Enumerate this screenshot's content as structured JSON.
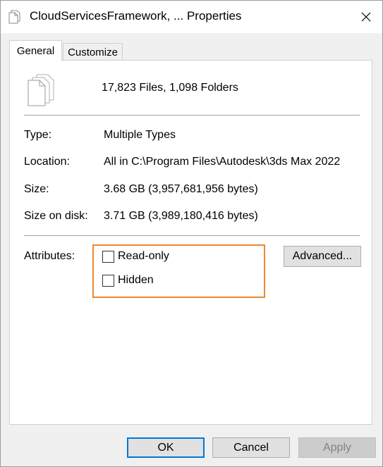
{
  "window": {
    "title": "CloudServicesFramework, ... Properties",
    "close_label": "✕"
  },
  "tabs": [
    {
      "label": "General",
      "active": true
    },
    {
      "label": "Customize",
      "active": false
    }
  ],
  "summary": "17,823 Files, 1,098 Folders",
  "details": [
    {
      "label": "Type:",
      "value": "Multiple Types"
    },
    {
      "label": "Location:",
      "value": "All in C:\\Program Files\\Autodesk\\3ds Max 2022"
    },
    {
      "label": "Size:",
      "value": "3.68 GB (3,957,681,956 bytes)"
    },
    {
      "label": "Size on disk:",
      "value": "3.71 GB (3,989,180,416 bytes)"
    }
  ],
  "attributes": {
    "label": "Attributes:",
    "read_only": {
      "label": "Read-only",
      "checked": false
    },
    "hidden": {
      "label": "Hidden",
      "checked": false
    },
    "advanced_label": "Advanced...",
    "highlight_color": "#f0862e"
  },
  "buttons": {
    "ok": "OK",
    "cancel": "Cancel",
    "apply": "Apply"
  },
  "colors": {
    "accent": "#0078d7",
    "disabled_text": "#838383"
  },
  "icons": {
    "title": "files-icon",
    "summary": "multiple-files-icon",
    "close": "close-icon"
  }
}
